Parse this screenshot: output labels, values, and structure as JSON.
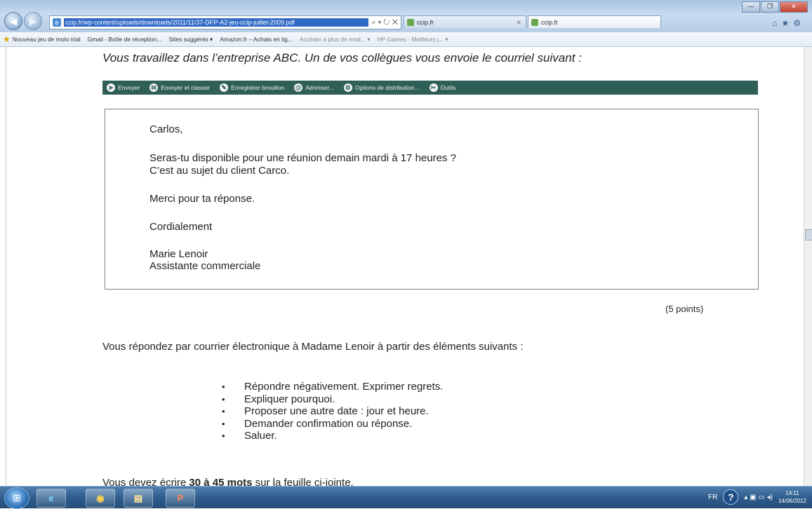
{
  "browser": {
    "url": "ccip.fr/wp-content/uploads/downloads/2011/11/37-DFP-A2-jeu-ccip-juillet-2009.pdf",
    "address_tools": "⌕ ▾ ↻ ✕",
    "tabs": [
      {
        "label": "ccip.fr"
      },
      {
        "label": "ccip.fr"
      }
    ],
    "favorites": [
      "Nouveau jeu de moto trial",
      "Gmail - Boîte de réception...",
      "Sites suggérés ▾",
      "Amazon.fr – Achats en lig...",
      "Accéder à plus de mod... ▾",
      "HP Games - Meilleurs j... ▾"
    ]
  },
  "document": {
    "intro": "Vous travaillez dans l’entreprise ABC. Un de vos collègues vous envoie le courriel suivant :",
    "mail_toolbar": [
      {
        "icon": "send-icon",
        "glyph": "➤",
        "label": "Envoyer"
      },
      {
        "icon": "send-save-icon",
        "glyph": "✉",
        "label": "Envoyer et classer"
      },
      {
        "icon": "draft-icon",
        "glyph": "✎",
        "label": "Enregistrer brouillon"
      },
      {
        "icon": "address-icon",
        "glyph": "@",
        "label": "Adresser..."
      },
      {
        "icon": "options-icon",
        "glyph": "⚙",
        "label": "Options de distribution..."
      },
      {
        "icon": "tools-icon",
        "glyph": "✂",
        "label": "Outils"
      }
    ],
    "email": {
      "greeting": "Carlos,",
      "body_line1": "Seras-tu disponible pour une réunion demain mardi à 17 heures ?",
      "body_line2": "C’est au sujet du client Carco.",
      "thanks": "Merci pour ta réponse.",
      "closing": "Cordialement",
      "sender_name": "Marie Lenoir",
      "sender_title": "Assistante commerciale"
    },
    "points": "(5 points)",
    "instruction": "Vous répondez par courrier électronique à Madame Lenoir à partir des éléments suivants :",
    "tasks": [
      "Répondre négativement. Exprimer regrets.",
      "Expliquer pourquoi.",
      "Proposer une autre date : jour et heure.",
      "Demander confirmation ou réponse.",
      "Saluer."
    ],
    "word_count": {
      "before": "Vous devez écrire ",
      "emphasis": "30 à 45 mots",
      "after": " sur la feuille ci-jointe."
    }
  },
  "taskbar": {
    "lang": "FR",
    "clock_time": "14:11",
    "clock_date": "14/06/2012"
  }
}
